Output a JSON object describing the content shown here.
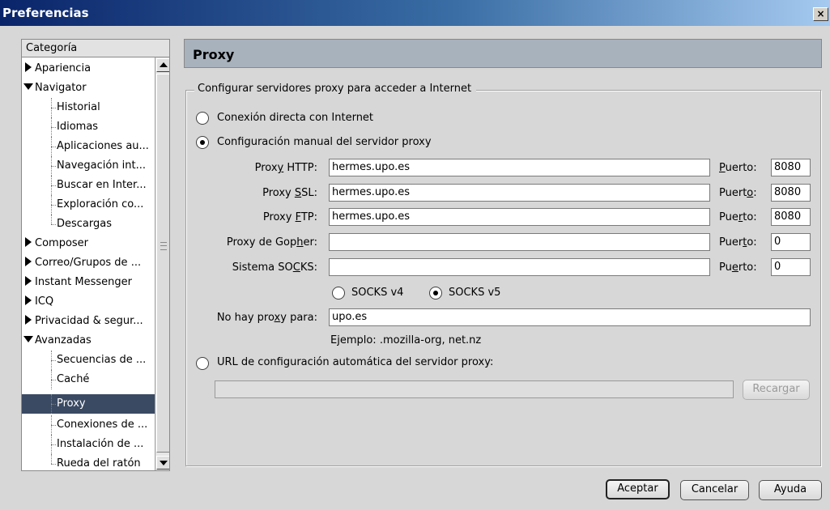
{
  "window": {
    "title": "Preferencias",
    "close_label": "×"
  },
  "sidebar": {
    "header": "Categoría",
    "items": [
      {
        "label": "Apariencia"
      },
      {
        "label": "Navigator"
      },
      {
        "label": "Historial"
      },
      {
        "label": "Idiomas"
      },
      {
        "label": "Aplicaciones au..."
      },
      {
        "label": "Navegación int..."
      },
      {
        "label": "Buscar en Inter..."
      },
      {
        "label": "Exploración co..."
      },
      {
        "label": "Descargas"
      },
      {
        "label": "Composer"
      },
      {
        "label": "Correo/Grupos de ..."
      },
      {
        "label": "Instant Messenger"
      },
      {
        "label": "ICQ"
      },
      {
        "label": "Privacidad & segur..."
      },
      {
        "label": "Avanzadas"
      },
      {
        "label": "Secuencias de ..."
      },
      {
        "label": "Caché"
      },
      {
        "label": "Proxy"
      },
      {
        "label": "Conexiones de ..."
      },
      {
        "label": "Instalación de ..."
      },
      {
        "label": "Rueda del ratón"
      }
    ],
    "selected": "Proxy"
  },
  "panel": {
    "title": "Proxy",
    "group_legend": "Configurar servidores proxy para acceder a Internet",
    "radio_direct": "Conexión directa con Internet",
    "radio_manual": "Configuración manual del servidor proxy",
    "radio_auto": "URL de configuración automática del servidor proxy:",
    "selected_mode": "manual",
    "rows": [
      {
        "label_pre": "Prox",
        "label_key": "y",
        "label_post": " HTTP:",
        "value": "hermes.upo.es",
        "port_pre": "",
        "port_key": "P",
        "port_post": "uerto:",
        "port": "8080"
      },
      {
        "label_pre": "Proxy ",
        "label_key": "S",
        "label_post": "SL:",
        "value": "hermes.upo.es",
        "port_pre": "Puert",
        "port_key": "o",
        "port_post": ":",
        "port": "8080"
      },
      {
        "label_pre": "Proxy ",
        "label_key": "F",
        "label_post": "TP:",
        "value": "hermes.upo.es",
        "port_pre": "Pue",
        "port_key": "r",
        "port_post": "to:",
        "port": "8080"
      },
      {
        "label_pre": "Proxy de Gop",
        "label_key": "h",
        "label_post": "er:",
        "value": "",
        "port_pre": "Puer",
        "port_key": "t",
        "port_post": "o:",
        "port": "0"
      },
      {
        "label_pre": "Sistema SO",
        "label_key": "C",
        "label_post": "KS:",
        "value": "",
        "port_pre": "Pu",
        "port_key": "e",
        "port_post": "rto:",
        "port": "0"
      }
    ],
    "socks_v4": "SOCKS v4",
    "socks_v5": "SOCKS v5",
    "socks_selected": "v5",
    "noproxy_pre": "No hay pro",
    "noproxy_key": "x",
    "noproxy_post": "y para:",
    "noproxy_value": "upo.es",
    "example": "Ejemplo: .mozilla-org, net.nz",
    "auto_url_value": "",
    "reload_pre": "Recar",
    "reload_key": "g",
    "reload_post": "ar"
  },
  "footer": {
    "accept": "Aceptar",
    "cancel": "Cancelar",
    "help": "Ayuda"
  },
  "colors": {
    "selection": "#3a4a63",
    "header_bg": "#a8b2bd",
    "title_gradient_start": "#0a246a"
  }
}
